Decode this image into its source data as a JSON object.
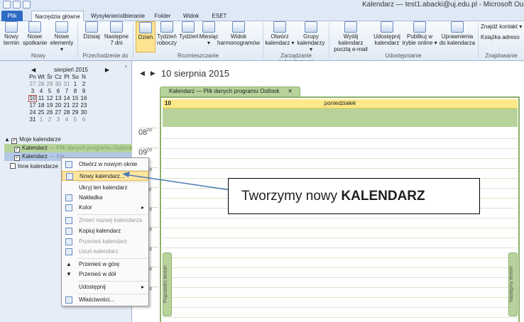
{
  "window": {
    "title": "Kalendarz — test1.abacki@uj.edu.pl - Microsoft Ou"
  },
  "tabs": [
    "Plik",
    "Narzędzia główne",
    "Wysyłanie/odbieranie",
    "Folder",
    "Widok",
    "ESET"
  ],
  "ribbon": {
    "buttons": [
      {
        "l1": "Nowy",
        "l2": "termin"
      },
      {
        "l1": "Nowe",
        "l2": "spotkanie"
      },
      {
        "l1": "Nowe",
        "l2": "elementy ▾"
      },
      {
        "l1": "Dzisiaj",
        "l2": ""
      },
      {
        "l1": "Następne",
        "l2": "7 dni"
      },
      {
        "l1": "Dzień",
        "l2": ""
      },
      {
        "l1": "Tydzień",
        "l2": "roboczy"
      },
      {
        "l1": "Tydzień",
        "l2": ""
      },
      {
        "l1": "Miesiąc",
        "l2": "▾"
      },
      {
        "l1": "Widok",
        "l2": "harmonogramów"
      },
      {
        "l1": "Otwórz",
        "l2": "kalendarz ▾"
      },
      {
        "l1": "Grupy",
        "l2": "kalendarzy ▾"
      },
      {
        "l1": "Wyślij kalendarz",
        "l2": "pocztą e-mail"
      },
      {
        "l1": "Udostępnij",
        "l2": "kalendarz"
      },
      {
        "l1": "Publikuj w",
        "l2": "trybie online ▾"
      },
      {
        "l1": "Uprawnienia",
        "l2": "do kalendarza"
      }
    ],
    "groups": [
      "Nowy",
      "Przechodzenie do",
      "Rozmieszczanie",
      "Zarządzanie kalendarzami",
      "Udostępnianie",
      "Znajdowanie"
    ],
    "find_contact": "Znajdź kontakt ▾",
    "address_book": "Książka adreso"
  },
  "mini_calendar": {
    "title": "sierpień 2015",
    "weekdays": [
      "Pn",
      "Wt",
      "Śr",
      "Cz",
      "Pt",
      "So",
      "N"
    ],
    "weeks": [
      [
        "27",
        "28",
        "29",
        "30",
        "31",
        "1",
        "2"
      ],
      [
        "3",
        "4",
        "5",
        "6",
        "7",
        "8",
        "9"
      ],
      [
        "10",
        "11",
        "12",
        "13",
        "14",
        "15",
        "16"
      ],
      [
        "17",
        "18",
        "19",
        "20",
        "21",
        "22",
        "23"
      ],
      [
        "24",
        "25",
        "26",
        "27",
        "28",
        "29",
        "30"
      ],
      [
        "31",
        "1",
        "2",
        "3",
        "4",
        "5",
        "6"
      ]
    ]
  },
  "tree": {
    "group1": "Moje kalendarze",
    "cal1": "Kalendarz",
    "cal1_sub": "— Plik danych programu Outlook",
    "cal2": "Kalendarz",
    "cal2_sub": "— Inb",
    "group2": "Inne kalendarze"
  },
  "main": {
    "date_title": "10 sierpnia 2015",
    "cal_tab": "Kalendarz — Plik danych programu Outlook",
    "day_num": "10",
    "day_name": "poniedziałek",
    "times": [
      "08",
      "09",
      "10",
      "11",
      "12",
      "13",
      "14",
      "15",
      "16"
    ],
    "time_minutes": "00",
    "prev_label": "Poprzedni termin",
    "next_label": "Następny termin"
  },
  "context_menu": [
    "Otwórz w nowym oknie",
    "Nowy kalendarz...",
    "Ukryj ten kalendarz",
    "Nakładka",
    "Kolor",
    "Zmień nazwę kalendarza",
    "Kopiuj kalendarz",
    "Przenieś kalendarz",
    "Usuń kalendarz",
    "Przenieś w górę",
    "Przenieś w dół",
    "Udostępnij",
    "Właściwości..."
  ],
  "callout": {
    "text": "Tworzymy nowy ",
    "bold": "KALENDARZ"
  }
}
